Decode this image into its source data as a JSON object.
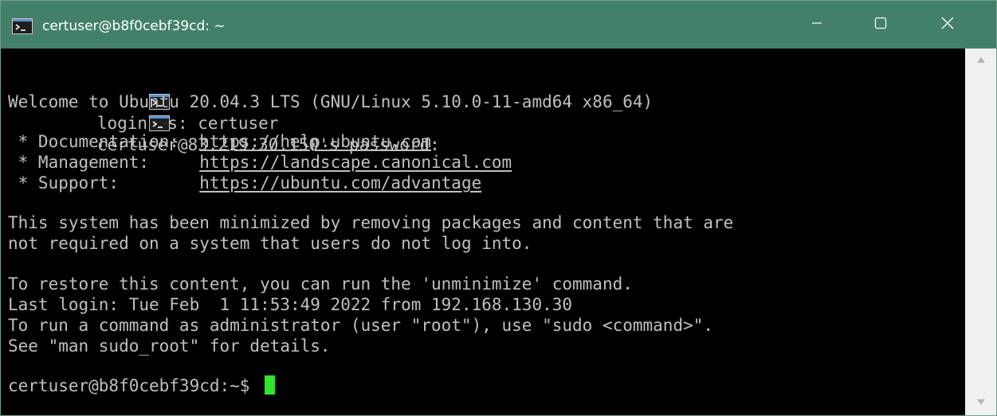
{
  "window": {
    "title": "certuser@b8f0cebf39cd: ~"
  },
  "terminal": {
    "lines": [
      {
        "text": "login as: certuser"
      },
      {
        "text": "certuser@83.219.30.150's password:"
      },
      {
        "text": "Welcome to Ubuntu 20.04.3 LTS (GNU/Linux 5.10.0-11-amd64 x86_64)"
      },
      {
        "text": ""
      },
      {
        "label": " * Documentation:  ",
        "link": "https://help.ubuntu.com"
      },
      {
        "label": " * Management:     ",
        "link": "https://landscape.canonical.com"
      },
      {
        "label": " * Support:        ",
        "link": "https://ubuntu.com/advantage"
      },
      {
        "text": ""
      },
      {
        "text": "This system has been minimized by removing packages and content that are"
      },
      {
        "text": "not required on a system that users do not log into."
      },
      {
        "text": ""
      },
      {
        "text": "To restore this content, you can run the 'unminimize' command."
      },
      {
        "text": "Last login: Tue Feb  1 11:53:49 2022 from 192.168.130.30"
      },
      {
        "text": "To run a command as administrator (user \"root\"), use \"sudo <command>\"."
      },
      {
        "text": "See \"man sudo_root\" for details."
      },
      {
        "text": ""
      },
      {
        "prompt": "certuser@b8f0cebf39cd:~$ "
      }
    ]
  },
  "colors": {
    "titlebar": "#43806a",
    "terminal_bg": "#000000",
    "terminal_fg": "#c0c0c0",
    "cursor": "#2ee62e"
  },
  "icons": {
    "app": "terminal-icon",
    "minimize": "minimize-icon",
    "maximize": "maximize-icon",
    "close": "close-icon",
    "scroll_up": "scroll-up-arrow-icon",
    "scroll_down": "scroll-down-arrow-icon"
  }
}
